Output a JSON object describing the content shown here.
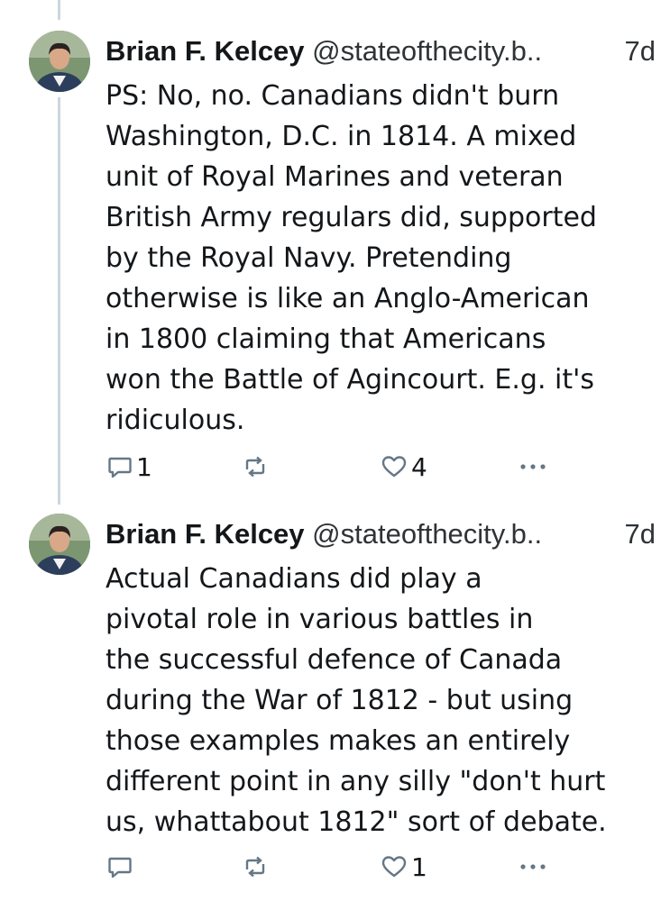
{
  "tweets": [
    {
      "author_name": "Brian F. Kelcey",
      "handle": "@stateofthecity.b..",
      "time": "7d",
      "text": "PS: No, no. Canadians didn't burn\nWashington, D.C. in 1814. A mixed\nunit of Royal Marines and veteran\nBritish Army regulars did, supported\nby the Royal Navy. Pretending\notherwise is like an Anglo-American\nin 1800 claiming that Americans\nwon the Battle of Agincourt. E.g. it's\nridiculous.",
      "reply_count": "1",
      "retweet_count": "",
      "like_count": "4"
    },
    {
      "author_name": "Brian F. Kelcey",
      "handle": "@stateofthecity.b..",
      "time": "7d",
      "text": "Actual Canadians did play a\npivotal role in various battles  in\nthe successful defence of Canada\nduring the War of 1812 - but using\nthose examples makes an entirely\ndifferent point in any silly \"don't hurt\nus, whattabout 1812\" sort of debate.",
      "reply_count": "",
      "retweet_count": "",
      "like_count": "1"
    }
  ],
  "icons": {
    "reply": "reply-icon",
    "retweet": "retweet-icon",
    "like": "heart-icon",
    "more": "more-icon",
    "accent": "#657786"
  }
}
